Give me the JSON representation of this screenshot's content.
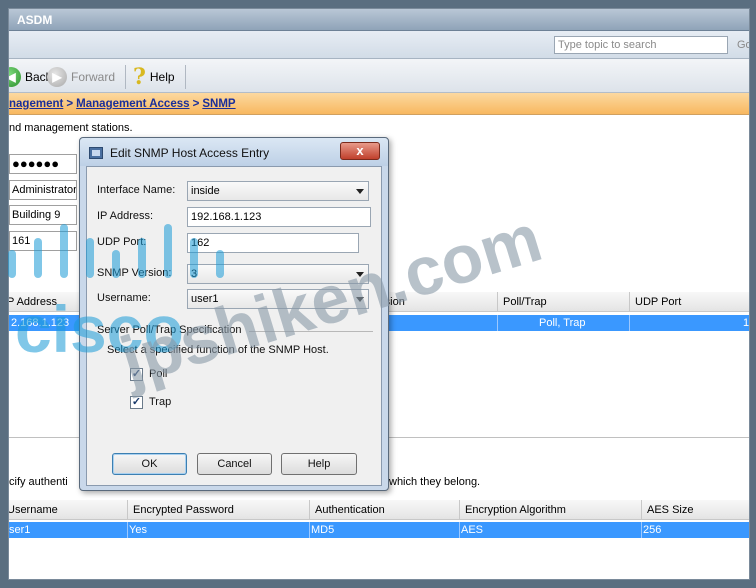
{
  "window": {
    "title": "ASDM"
  },
  "search": {
    "placeholder": "Type topic to search",
    "go_label": "Go"
  },
  "toolbar": {
    "back": "Back",
    "forward": "Forward",
    "help": "Help"
  },
  "breadcrumb": {
    "items": [
      "nagement",
      "Management Access",
      "SNMP"
    ],
    "separator": ">"
  },
  "background": {
    "desc_text": "nd management stations.",
    "field_password": "●●●●●●",
    "field_contact": "Administrator",
    "field_location": "Building 9",
    "field_port": "161",
    "host_table": {
      "headers": [
        "P Address",
        "rsion",
        "Poll/Trap",
        "UDP Port"
      ],
      "row": [
        "2.168.1.123",
        "",
        "Poll, Trap",
        "1"
      ]
    },
    "auth_text_left": "cify authenti",
    "auth_text_right": "which they belong.",
    "user_table": {
      "headers": [
        "Username",
        "Encrypted Password",
        "Authentication",
        "Encryption Algorithm",
        "AES Size"
      ],
      "row": [
        "ser1",
        "Yes",
        "MD5",
        "AES",
        "256"
      ]
    }
  },
  "dialog": {
    "title": "Edit SNMP Host Access Entry",
    "close_label": "x",
    "interface_label": "Interface Name:",
    "interface_value": "inside",
    "ip_label": "IP Address:",
    "ip_value": "192.168.1.123",
    "port_label": "UDP Port:",
    "port_value": "162",
    "version_label": "SNMP Version:",
    "version_value": "3",
    "username_label": "Username:",
    "username_value": "user1",
    "group_title": "Server Poll/Trap Specification",
    "group_desc": "Select a specified function of the SNMP Host.",
    "poll_label": "Poll",
    "trap_label": "Trap",
    "poll_checked": true,
    "trap_checked": true,
    "ok_label": "OK",
    "cancel_label": "Cancel",
    "help_label": "Help"
  },
  "watermark": {
    "text": "jpshiken.com",
    "logo": "cisco"
  },
  "colors": {
    "selection": "#3a98ff",
    "breadcrumb_bg": "#f8b860",
    "dialog_frame": "#c9d8ea"
  }
}
